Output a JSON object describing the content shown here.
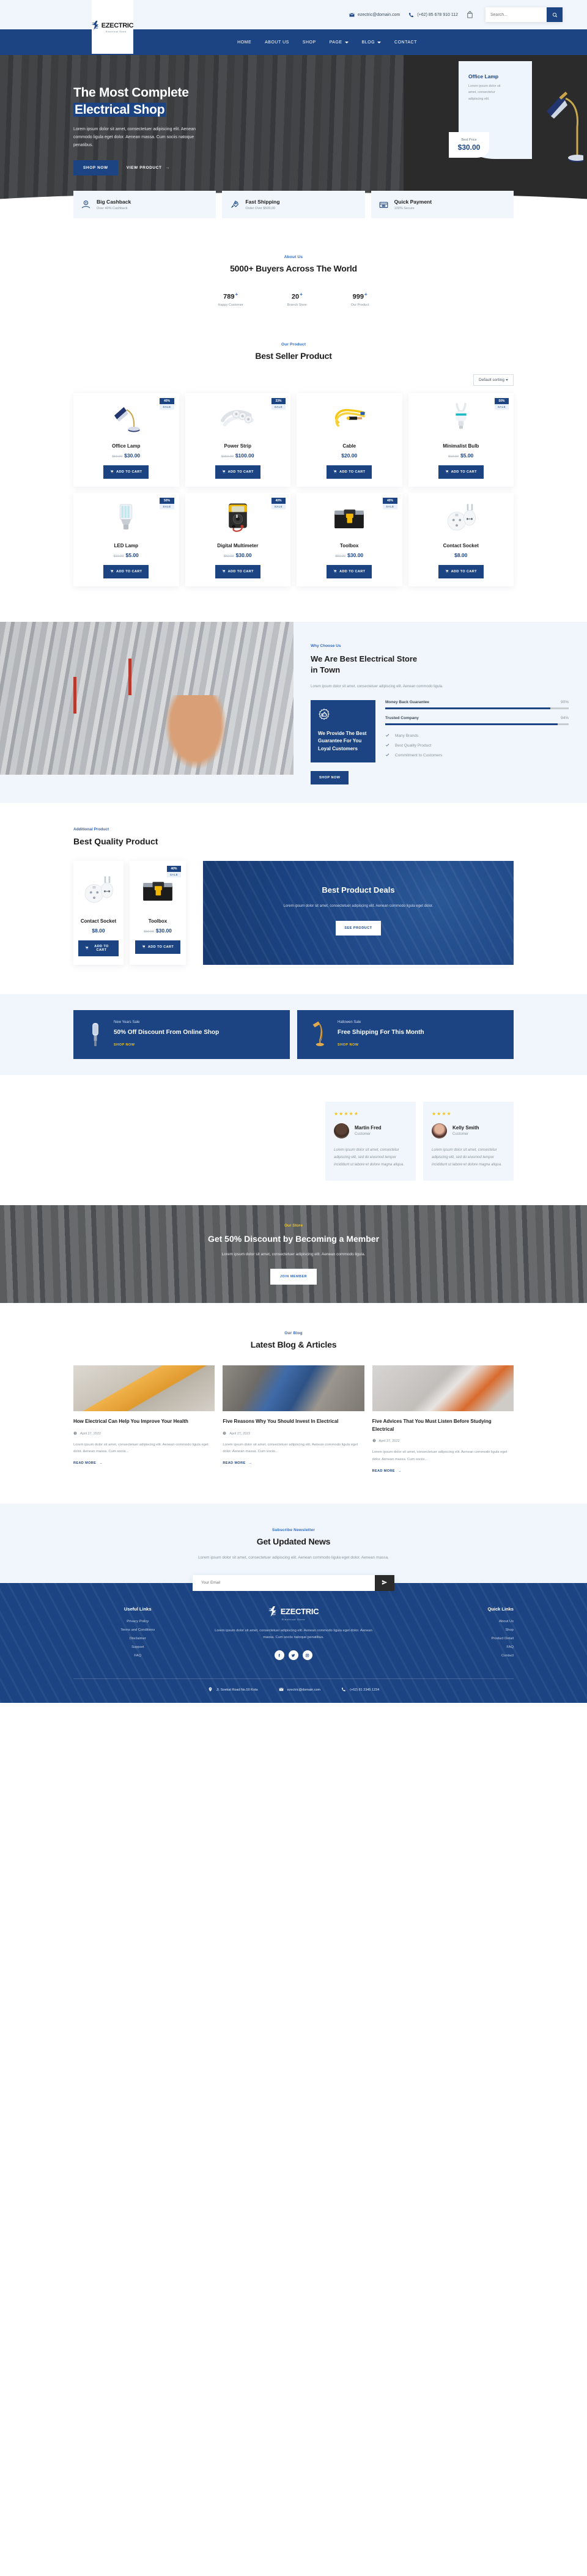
{
  "brand": {
    "name": "EZECTRIC",
    "tagline": "Electrical Store"
  },
  "topbar": {
    "email": "ezectric@domain.com",
    "phone": "(+62) 85 678 910 112",
    "search_placeholder": "Search..."
  },
  "nav": {
    "items": [
      {
        "label": "HOME",
        "dropdown": false
      },
      {
        "label": "ABOUT US",
        "dropdown": false
      },
      {
        "label": "SHOP",
        "dropdown": false
      },
      {
        "label": "PAGE",
        "dropdown": true
      },
      {
        "label": "BLOG",
        "dropdown": true
      },
      {
        "label": "CONTACT",
        "dropdown": false
      }
    ]
  },
  "hero": {
    "title_line1": "The Most Complete",
    "title_line2": "Electrical Shop",
    "paragraph": "Lorem ipsum dolor sit amet, consectetuer adipiscing elit. Aenean commodo ligula eget dolor. Aenean massa. Cum sociis natoque penatibus.",
    "primary_button": "SHOP NOW",
    "secondary_button": "VIEW PRODUCT",
    "card": {
      "title": "Office Lamp",
      "text": "Lorem ipsum dolor sit amet, consectetur adipiscing elit.",
      "price_label": "Best Price",
      "price": "$30.00"
    }
  },
  "features": [
    {
      "title": "Big Cashback",
      "subtitle": "Over 40% Cashback",
      "icon": "cashback-icon"
    },
    {
      "title": "Fast Shipping",
      "subtitle": "Order Over $500,00",
      "icon": "rocket-icon"
    },
    {
      "title": "Quick Payment",
      "subtitle": "100% Secure",
      "icon": "payment-icon"
    }
  ],
  "about": {
    "eyebrow": "About Us",
    "title": "5000+ Buyers Across The World",
    "stats": [
      {
        "number": "789",
        "plus": "+",
        "label": "Happy Customer"
      },
      {
        "number": "20",
        "plus": "+",
        "label": "Branch Store"
      },
      {
        "number": "999",
        "plus": "+",
        "label": "Our Product"
      }
    ]
  },
  "products": {
    "eyebrow": "Our Product",
    "title": "Best Seller Product",
    "sort_value": "Default sorting",
    "cart_label": "ADD TO CART",
    "sale_label": "SALE",
    "items": [
      {
        "name": "Office Lamp",
        "old_price": "$50.00",
        "price": "$30.00",
        "discount": "40%",
        "has_badge": true,
        "icon": "office-lamp"
      },
      {
        "name": "Power Strip",
        "old_price": "$150.00",
        "price": "$100.00",
        "discount": "33%",
        "has_badge": true,
        "icon": "power-strip"
      },
      {
        "name": "Cable",
        "old_price": "",
        "price": "$20.00",
        "discount": "",
        "has_badge": false,
        "icon": "cable"
      },
      {
        "name": "Minimalist Bulb",
        "old_price": "$10.00",
        "price": "$5.00",
        "discount": "50%",
        "has_badge": true,
        "icon": "minimalist-bulb"
      },
      {
        "name": "LED Lamp",
        "old_price": "$10.00",
        "price": "$5.00",
        "discount": "50%",
        "has_badge": true,
        "icon": "led-lamp"
      },
      {
        "name": "Digital Multimeter",
        "old_price": "$50.00",
        "price": "$30.00",
        "discount": "40%",
        "has_badge": true,
        "icon": "multimeter"
      },
      {
        "name": "Toolbox",
        "old_price": "$50.00",
        "price": "$30.00",
        "discount": "40%",
        "has_badge": true,
        "icon": "toolbox"
      },
      {
        "name": "Contact Socket",
        "old_price": "",
        "price": "$8.00",
        "discount": "",
        "has_badge": false,
        "icon": "socket"
      }
    ]
  },
  "why": {
    "eyebrow": "Why Choose Us",
    "title_line1": "We Are Best Electrical Store",
    "title_line2": "in Town",
    "paragraph": "Lorem ipsum dolor sit amet, consectetuer adipiscing elit. Aenean commodo ligula.",
    "guarantee_title": "We Provide The Best Guarantee For You Loyal Customers",
    "bars": [
      {
        "label": "Money Back Guarantee",
        "value": "90%",
        "pct": 90
      },
      {
        "label": "Trusted Company",
        "value": "94%",
        "pct": 94
      }
    ],
    "checks": [
      "Many Brands",
      "Best Quality Product",
      "Commitment to Customers"
    ],
    "button": "SHOP NOW"
  },
  "quality": {
    "eyebrow": "Additional Product",
    "title": "Best Quality Product",
    "cart_label": "ADD TO CART",
    "sale_label": "SALE",
    "items": [
      {
        "name": "Contact Socket",
        "old_price": "",
        "price": "$8.00",
        "discount": "",
        "has_badge": false,
        "icon": "socket"
      },
      {
        "name": "Toolbox",
        "old_price": "$50.00",
        "price": "$30.00",
        "discount": "40%",
        "has_badge": true,
        "icon": "toolbox"
      }
    ],
    "deals": {
      "title": "Best Product Deals",
      "text": "Lorem ipsum dolor sit amet, consectetuer adipiscing elit. Aenean commodo ligula eget dolor.",
      "button": "SEE PRODUCT"
    }
  },
  "promos": [
    {
      "kicker": "New Years Sale",
      "title": "50% Off Discount From Online Shop",
      "link": "SHOP NOW",
      "icon": "street-lamp-icon"
    },
    {
      "kicker": "Hallowen Sale",
      "title": "Free Shipping For This Month",
      "link": "SHOP NOW",
      "icon": "desk-lamp-icon"
    }
  ],
  "testimonials": [
    {
      "stars": 5,
      "name": "Martin Fred",
      "role": "Customer",
      "quote": "Lorem ipsum dolor sit amet, consectetur adipiscing elit, sed do eiusmod tempor incididunt ut labore et dolore magna aliqua."
    },
    {
      "stars": 4,
      "name": "Kelly Smith",
      "role": "Customer",
      "quote": "Lorem ipsum dolor sit amet, consectetur adipiscing elit, sed do eiusmod tempor incididunt ut labore et dolore magna aliqua."
    }
  ],
  "member": {
    "eyebrow": "Our Store",
    "title": "Get 50% Discount by Becoming a Member",
    "text": "Lorem ipsum dolor sit amet, consectetuer adipiscing elit. Aenean commodo ligula.",
    "button": "JOIN MEMBER"
  },
  "blog": {
    "eyebrow": "Our Blog",
    "title": "Latest Blog & Articles",
    "read_more": "READ MORE",
    "posts": [
      {
        "title": "How Electrical Can Help You Improve Your Health",
        "date": "April 27, 2022",
        "excerpt": "Lorem ipsum dolor sit amet, consectetuer adipiscing elit. Aenean commodo ligula eget dolor. Aenean massa. Cum sociis..."
      },
      {
        "title": "Five Reasons Why You Should Invest In Electrical",
        "date": "April 27, 2022",
        "excerpt": "Lorem ipsum dolor sit amet, consectetuer adipiscing elit. Aenean commodo ligula eget dolor. Aenean massa. Cum sociis..."
      },
      {
        "title": "Five Advices That You Must Listen Before Studying Electrical",
        "date": "April 27, 2022",
        "excerpt": "Lorem ipsum dolor sit amet, consectetuer adipiscing elit. Aenean commodo ligula eget dolor. Aenean massa. Cum sociis..."
      }
    ]
  },
  "newsletter": {
    "eyebrow": "Subscribe Newsletter",
    "title": "Get Updated News",
    "text": "Lorem ipsum dolor sit amet, consectetuer adipiscing elit. Aenean commodo ligula eget dolor. Aenean massa.",
    "placeholder": "Your Email"
  },
  "footer": {
    "useful_links_title": "Useful Links",
    "useful_links": [
      "Privacy Policy",
      "Terms and Conditions",
      "Disclaimer",
      "Support",
      "FAQ"
    ],
    "quick_links_title": "Quick Links",
    "quick_links": [
      "About Us",
      "Shop",
      "Product Detail",
      "FAQ",
      "Contact"
    ],
    "description": "Lorem ipsum dolor sit amet, consectetuer adipiscing elit. Aenean commodo ligula eget dolor. Aenean massa. Cum sociis natoque penatibus.",
    "socials": [
      "facebook-icon",
      "twitter-icon",
      "instagram-icon"
    ],
    "contact": {
      "address": "Jl. Soekat Road No.50 Kota",
      "email": "ezectric@domain.com",
      "phone": "(+62) 81 2345 1234"
    }
  },
  "colors": {
    "primary": "#1c4483",
    "accent_light": "#f0f6fc",
    "link_blue": "#3168c4",
    "yellow": "#f2c41a"
  }
}
